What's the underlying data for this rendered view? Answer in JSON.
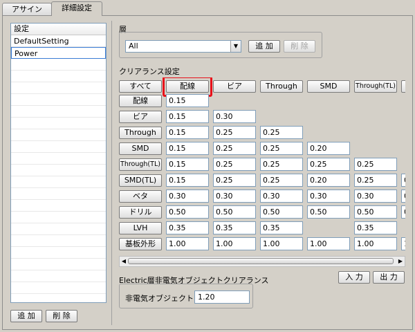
{
  "tabs": [
    {
      "label": "アサイン"
    },
    {
      "label": "詳細設定"
    }
  ],
  "settings_list": {
    "header": "設定",
    "items": [
      {
        "label": "DefaultSetting"
      },
      {
        "label": "Power"
      }
    ]
  },
  "left_buttons": {
    "add": "追 加",
    "delete": "削 除"
  },
  "layer": {
    "title": "層",
    "selected": "All",
    "add": "追 加",
    "delete": "削 除"
  },
  "clearance": {
    "title": "クリアランス設定",
    "headers": [
      "すべて",
      "配線",
      "ビア",
      "Through",
      "SMD",
      "Through(TL)",
      ""
    ],
    "highlighted_header": "配線",
    "rows": [
      {
        "label": "配線",
        "values": [
          "0.15"
        ]
      },
      {
        "label": "ビア",
        "values": [
          "0.15",
          "0.30"
        ]
      },
      {
        "label": "Through",
        "values": [
          "0.15",
          "0.25",
          "0.25"
        ]
      },
      {
        "label": "SMD",
        "values": [
          "0.15",
          "0.25",
          "0.25",
          "0.20"
        ]
      },
      {
        "label": "Through(TL)",
        "values": [
          "0.15",
          "0.25",
          "0.25",
          "0.25",
          "0.25"
        ]
      },
      {
        "label": "SMD(TL)",
        "values": [
          "0.15",
          "0.25",
          "0.25",
          "0.20",
          "0.25",
          "0"
        ]
      },
      {
        "label": "ベタ",
        "values": [
          "0.30",
          "0.30",
          "0.30",
          "0.30",
          "0.30",
          "0"
        ]
      },
      {
        "label": "ドリル",
        "values": [
          "0.50",
          "0.50",
          "0.50",
          "0.50",
          "0.50",
          "0"
        ]
      },
      {
        "label": "LVH",
        "values": [
          "0.35",
          "0.35",
          "0.35",
          "",
          "0.35",
          ""
        ]
      },
      {
        "label": "基板外形",
        "values": [
          "1.00",
          "1.00",
          "1.00",
          "1.00",
          "1.00",
          "1"
        ]
      }
    ]
  },
  "io_buttons": {
    "input": "入 力",
    "output": "出 力"
  },
  "electric": {
    "title": "Electric層非電気オブジェクトクリアランス",
    "label": "非電気オブジェクト",
    "value": "1.20"
  },
  "colors": {
    "highlight": "#e8101a",
    "selection_border": "#3a7bd5"
  }
}
